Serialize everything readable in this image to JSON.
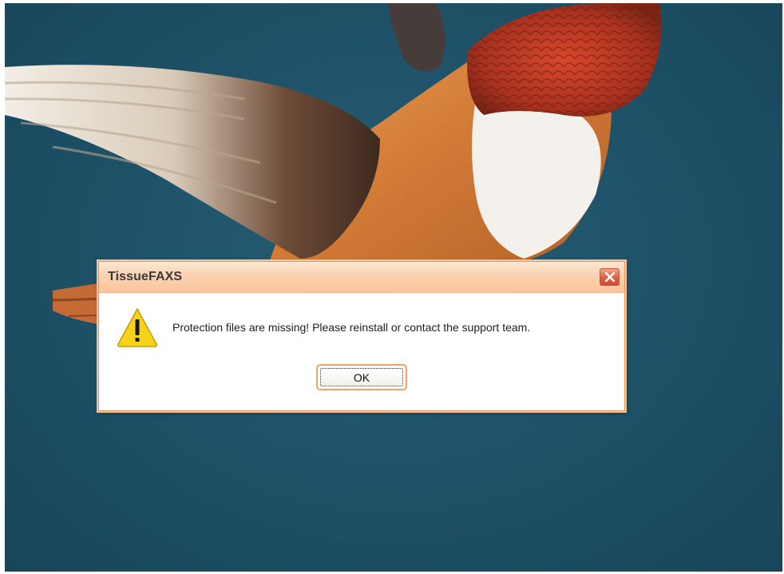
{
  "dialog": {
    "title": "TissueFAXS",
    "message": "Protection files are missing! Please reinstall or contact the support team.",
    "ok_label": "OK",
    "close_icon": "close-icon",
    "message_icon": "warning-icon"
  },
  "colors": {
    "desktop_background": "#1f5369",
    "titlebar": "#fbd2b0",
    "dialog_border": "#e9955c",
    "close_button": "#e0634a",
    "warning_yellow": "#f7d21a"
  }
}
